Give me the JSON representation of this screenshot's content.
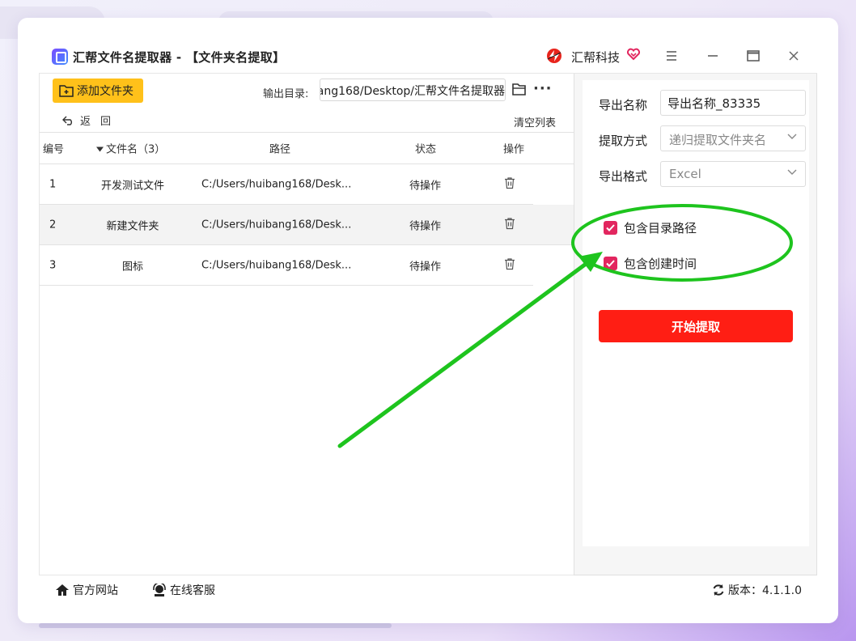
{
  "window": {
    "title": "汇帮文件名提取器 - 【文件夹名提取】",
    "brand": "汇帮科技",
    "controls": [
      "menu",
      "minimize",
      "maximize",
      "close"
    ]
  },
  "toolbar": {
    "add_folder": "添加文件夹",
    "output_label": "输出目录:",
    "output_path": "ang168/Desktop/汇帮文件名提取器",
    "back": "返回",
    "clear": "清空列表"
  },
  "table": {
    "headers": {
      "no": "编号",
      "name": "文件名（3）",
      "path": "路径",
      "state": "状态",
      "op": "操作"
    },
    "rows": [
      {
        "no": "1",
        "name": "开发测试文件",
        "path": "C:/Users/huibang168/Desk...",
        "state": "待操作"
      },
      {
        "no": "2",
        "name": "新建文件夹",
        "path": "C:/Users/huibang168/Desk...",
        "state": "待操作"
      },
      {
        "no": "3",
        "name": "图标",
        "path": "C:/Users/huibang168/Desk...",
        "state": "待操作"
      }
    ]
  },
  "settings": {
    "export_name_label": "导出名称",
    "export_name_value": "导出名称_83335",
    "extract_mode_label": "提取方式",
    "extract_mode_value": "递归提取文件夹名",
    "export_format_label": "导出格式",
    "export_format_value": "Excel",
    "include_path": "包含目录路径",
    "include_time": "包含创建时间",
    "start": "开始提取"
  },
  "footer": {
    "website": "官方网站",
    "support": "在线客服",
    "version": "版本：4.1.1.0"
  },
  "colors": {
    "accent_yellow": "#ffc11a",
    "start_red": "#ff1e14",
    "check_pink": "#e2265f",
    "annotation_green": "#1ec41e"
  }
}
